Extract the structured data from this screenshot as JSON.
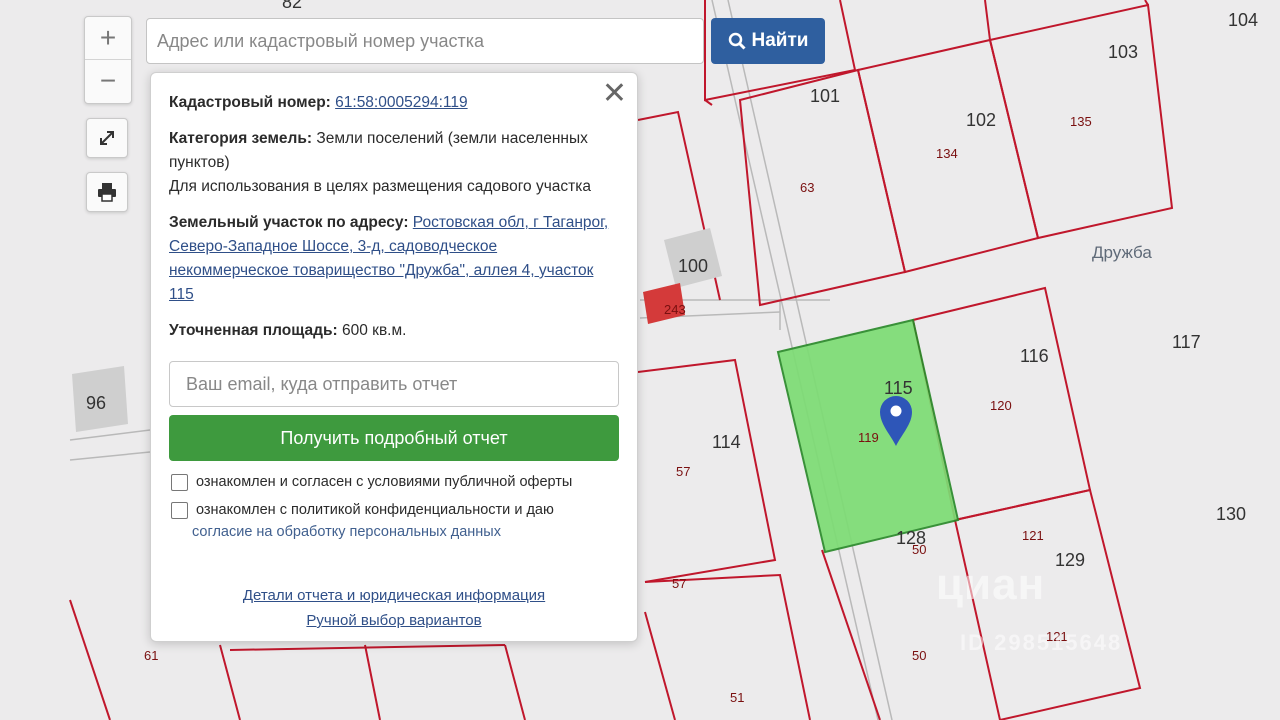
{
  "map": {
    "labels_big": [
      "82",
      "104",
      "103",
      "101",
      "102",
      "100",
      "96",
      "116",
      "117",
      "114",
      "115",
      "128",
      "129",
      "130"
    ],
    "labels_small": [
      "135",
      "134",
      "63",
      "243",
      "120",
      "119",
      "57",
      "57",
      "50",
      "121",
      "50",
      "121",
      "51",
      "61"
    ],
    "street": "Дружба",
    "colors": {
      "parcel_border": "#c0172c",
      "selected_fill": "#7ddc74",
      "selected_border": "#2a8a2a",
      "marker": "#2e56b8"
    }
  },
  "controls": {
    "zoom_in": "+",
    "zoom_out": "−",
    "fullscreen_icon": "fullscreen-icon",
    "print_icon": "printer-icon"
  },
  "search": {
    "placeholder": "Адрес или кадастровый номер участка",
    "button_label": "Найти"
  },
  "popup": {
    "cadastral_label": "Кадастровый номер:",
    "cadastral_value": "61:58:0005294:119",
    "category_label": "Категория земель:",
    "category_value": "Земли поселений (земли населенных пунктов)",
    "usage": "Для использования в целях размещения садового участка",
    "address_label": "Земельный участок по адресу:",
    "address_value": "Ростовская обл, г Таганрог, Северо-Западное Шоссе, 3-д, садоводческое некоммерческое товарищество \"Дружба\", аллея 4, участок 115",
    "area_label": "Уточненная площадь:",
    "area_value": "600 кв.м.",
    "email_placeholder": "Ваш email, куда отправить отчет",
    "report_button": "Получить подробный отчет",
    "consent_offer": "ознакомлен и согласен с условиями публичной оферты",
    "consent_privacy_1": "ознакомлен с политикой конфиденциальности и даю",
    "consent_privacy_2": "согласие на обработку персональных данных",
    "link_details": "Детали отчета и юридическая информация",
    "link_manual": "Ручной выбор вариантов"
  },
  "watermark": {
    "brand": "циан",
    "id": "ID 298515648"
  }
}
